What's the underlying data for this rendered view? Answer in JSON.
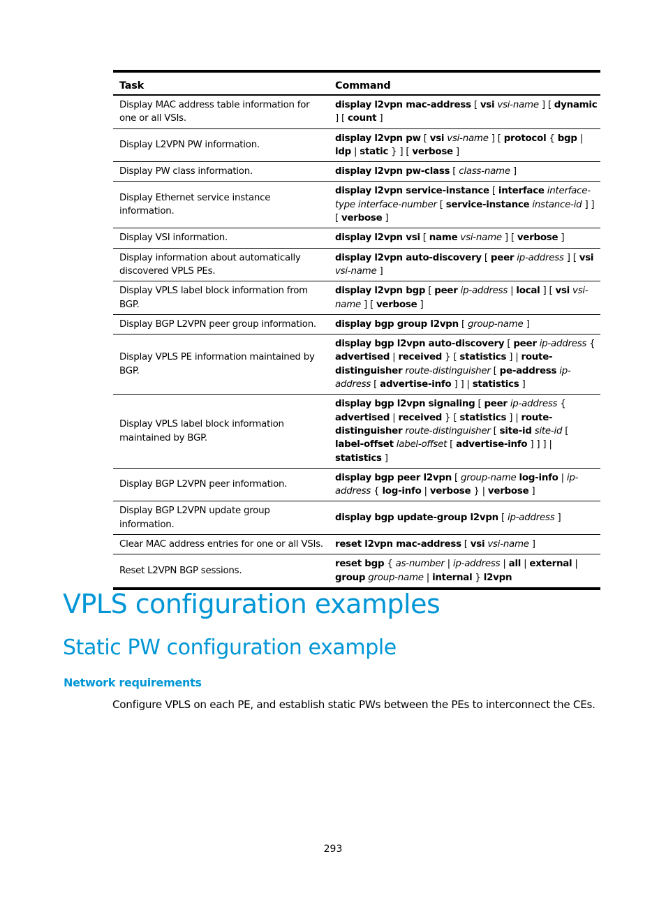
{
  "table": {
    "headers": [
      "Task",
      "Command"
    ],
    "rows": [
      {
        "task": "Display MAC address table information for one or all VSIs.",
        "command": [
          [
            "b",
            "display l2vpn mac-address"
          ],
          [
            "n",
            " [ "
          ],
          [
            "b",
            "vsi"
          ],
          [
            "n",
            " "
          ],
          [
            "i",
            "vsi-name"
          ],
          [
            "n",
            " ] [ "
          ],
          [
            "b",
            "dynamic"
          ],
          [
            "n",
            " ] [ "
          ],
          [
            "b",
            "count"
          ],
          [
            "n",
            " ]"
          ]
        ]
      },
      {
        "task": "Display L2VPN PW information.",
        "command": [
          [
            "b",
            "display l2vpn pw"
          ],
          [
            "n",
            " [ "
          ],
          [
            "b",
            "vsi"
          ],
          [
            "n",
            " "
          ],
          [
            "i",
            "vsi-name"
          ],
          [
            "n",
            " ] [ "
          ],
          [
            "b",
            "protocol"
          ],
          [
            "n",
            " { "
          ],
          [
            "b",
            "bgp"
          ],
          [
            "n",
            " | "
          ],
          [
            "b",
            "ldp"
          ],
          [
            "n",
            " | "
          ],
          [
            "b",
            "static"
          ],
          [
            "n",
            " } ] [ "
          ],
          [
            "b",
            "verbose"
          ],
          [
            "n",
            " ]"
          ]
        ]
      },
      {
        "task": "Display PW class information.",
        "command": [
          [
            "b",
            "display l2vpn pw-class"
          ],
          [
            "n",
            " [ "
          ],
          [
            "i",
            "class-name"
          ],
          [
            "n",
            " ]"
          ]
        ]
      },
      {
        "task": "Display Ethernet service instance information.",
        "command": [
          [
            "b",
            "display l2vpn service-instance"
          ],
          [
            "n",
            " [ "
          ],
          [
            "b",
            "interface"
          ],
          [
            "n",
            " "
          ],
          [
            "i",
            "interface-type interface-number"
          ],
          [
            "n",
            " [ "
          ],
          [
            "b",
            "service-instance"
          ],
          [
            "n",
            " "
          ],
          [
            "i",
            "instance-id"
          ],
          [
            "n",
            " ] ] [ "
          ],
          [
            "b",
            "verbose"
          ],
          [
            "n",
            " ]"
          ]
        ]
      },
      {
        "task": "Display VSI information.",
        "command": [
          [
            "b",
            "display l2vpn vsi"
          ],
          [
            "n",
            " [ "
          ],
          [
            "b",
            "name"
          ],
          [
            "n",
            " "
          ],
          [
            "i",
            "vsi-name"
          ],
          [
            "n",
            " ] [ "
          ],
          [
            "b",
            "verbose"
          ],
          [
            "n",
            " ]"
          ]
        ]
      },
      {
        "task": "Display information about automatically discovered VPLS PEs.",
        "command": [
          [
            "b",
            "display l2vpn auto-discovery"
          ],
          [
            "n",
            " [ "
          ],
          [
            "b",
            "peer"
          ],
          [
            "n",
            " "
          ],
          [
            "i",
            "ip-address"
          ],
          [
            "n",
            " ] [ "
          ],
          [
            "b",
            "vsi"
          ],
          [
            "n",
            " "
          ],
          [
            "i",
            "vsi-name"
          ],
          [
            "n",
            " ]"
          ]
        ]
      },
      {
        "task": "Display VPLS label block information from BGP.",
        "command": [
          [
            "b",
            "display l2vpn bgp"
          ],
          [
            "n",
            " [ "
          ],
          [
            "b",
            "peer"
          ],
          [
            "n",
            " "
          ],
          [
            "i",
            "ip-address"
          ],
          [
            "n",
            " | "
          ],
          [
            "b",
            "local"
          ],
          [
            "n",
            " ] [ "
          ],
          [
            "b",
            "vsi"
          ],
          [
            "n",
            " "
          ],
          [
            "i",
            "vsi-name"
          ],
          [
            "n",
            " ] [ "
          ],
          [
            "b",
            "verbose"
          ],
          [
            "n",
            " ]"
          ]
        ]
      },
      {
        "task": "Display BGP L2VPN peer group information.",
        "command": [
          [
            "b",
            "display bgp group l2vpn"
          ],
          [
            "n",
            " [ "
          ],
          [
            "i",
            "group-name"
          ],
          [
            "n",
            " ]"
          ]
        ]
      },
      {
        "task": "Display VPLS PE information maintained by BGP.",
        "command": [
          [
            "b",
            "display bgp l2vpn auto-discovery"
          ],
          [
            "n",
            " [ "
          ],
          [
            "b",
            "peer"
          ],
          [
            "n",
            " "
          ],
          [
            "i",
            "ip-address"
          ],
          [
            "n",
            " { "
          ],
          [
            "b",
            "advertised"
          ],
          [
            "n",
            " | "
          ],
          [
            "b",
            "received"
          ],
          [
            "n",
            " } [ "
          ],
          [
            "b",
            "statistics"
          ],
          [
            "n",
            " ] | "
          ],
          [
            "b",
            "route-distinguisher"
          ],
          [
            "n",
            " "
          ],
          [
            "i",
            "route-distinguisher"
          ],
          [
            "n",
            " [ "
          ],
          [
            "b",
            "pe-address"
          ],
          [
            "n",
            " "
          ],
          [
            "i",
            "ip-address"
          ],
          [
            "n",
            " [ "
          ],
          [
            "b",
            "advertise-info"
          ],
          [
            "n",
            " ] ] | "
          ],
          [
            "b",
            "statistics"
          ],
          [
            "n",
            " ]"
          ]
        ]
      },
      {
        "task": "Display VPLS label block information maintained by BGP.",
        "command": [
          [
            "b",
            "display bgp l2vpn signaling"
          ],
          [
            "n",
            " [ "
          ],
          [
            "b",
            "peer"
          ],
          [
            "n",
            " "
          ],
          [
            "i",
            "ip-address"
          ],
          [
            "n",
            " { "
          ],
          [
            "b",
            "advertised"
          ],
          [
            "n",
            " | "
          ],
          [
            "b",
            "received"
          ],
          [
            "n",
            " } [ "
          ],
          [
            "b",
            "statistics"
          ],
          [
            "n",
            " ] | "
          ],
          [
            "b",
            "route-distinguisher"
          ],
          [
            "n",
            " "
          ],
          [
            "i",
            "route-distinguisher"
          ],
          [
            "n",
            " [ "
          ],
          [
            "b",
            "site-id"
          ],
          [
            "n",
            " "
          ],
          [
            "i",
            "site-id"
          ],
          [
            "n",
            " [ "
          ],
          [
            "b",
            "label-offset"
          ],
          [
            "n",
            " "
          ],
          [
            "i",
            "label-offset"
          ],
          [
            "n",
            " [ "
          ],
          [
            "b",
            "advertise-info"
          ],
          [
            "n",
            " ] ] ] | "
          ],
          [
            "b",
            "statistics"
          ],
          [
            "n",
            " ]"
          ]
        ]
      },
      {
        "task": "Display BGP L2VPN peer information.",
        "command": [
          [
            "b",
            "display bgp peer l2vpn"
          ],
          [
            "n",
            " [ "
          ],
          [
            "i",
            "group-name"
          ],
          [
            "n",
            " "
          ],
          [
            "b",
            "log-info"
          ],
          [
            "n",
            " | "
          ],
          [
            "i",
            "ip-address"
          ],
          [
            "n",
            " { "
          ],
          [
            "b",
            "log-info"
          ],
          [
            "n",
            " | "
          ],
          [
            "b",
            "verbose"
          ],
          [
            "n",
            " } | "
          ],
          [
            "b",
            "verbose"
          ],
          [
            "n",
            " ]"
          ]
        ]
      },
      {
        "task": "Display BGP L2VPN update group information.",
        "command": [
          [
            "b",
            "display bgp update-group l2vpn"
          ],
          [
            "n",
            " [ "
          ],
          [
            "i",
            "ip-address"
          ],
          [
            "n",
            " ]"
          ]
        ]
      },
      {
        "task": "Clear MAC address entries for one or all VSIs.",
        "command": [
          [
            "b",
            "reset l2vpn mac-address"
          ],
          [
            "n",
            " [ "
          ],
          [
            "b",
            "vsi"
          ],
          [
            "n",
            " "
          ],
          [
            "i",
            "vsi-name"
          ],
          [
            "n",
            " ]"
          ]
        ]
      },
      {
        "task": "Reset L2VPN BGP sessions.",
        "command": [
          [
            "b",
            "reset bgp"
          ],
          [
            "n",
            " { "
          ],
          [
            "i",
            "as-number"
          ],
          [
            "n",
            " | "
          ],
          [
            "i",
            "ip-address"
          ],
          [
            "n",
            " | "
          ],
          [
            "b",
            "all"
          ],
          [
            "n",
            " | "
          ],
          [
            "b",
            "external"
          ],
          [
            "n",
            " | "
          ],
          [
            "b",
            "group"
          ],
          [
            "n",
            " "
          ],
          [
            "i",
            "group-name"
          ],
          [
            "n",
            " | "
          ],
          [
            "b",
            "internal"
          ],
          [
            "n",
            " } "
          ],
          [
            "b",
            "l2vpn"
          ]
        ]
      }
    ]
  },
  "headings": {
    "h1": "VPLS configuration examples",
    "h2": "Static PW configuration example",
    "h3": "Network requirements"
  },
  "paragraph": "Configure VPLS on each PE, and establish static PWs between the PEs to interconnect the CEs.",
  "page_number": "293",
  "colors": {
    "heading": "#0096d6",
    "text": "#000000"
  }
}
